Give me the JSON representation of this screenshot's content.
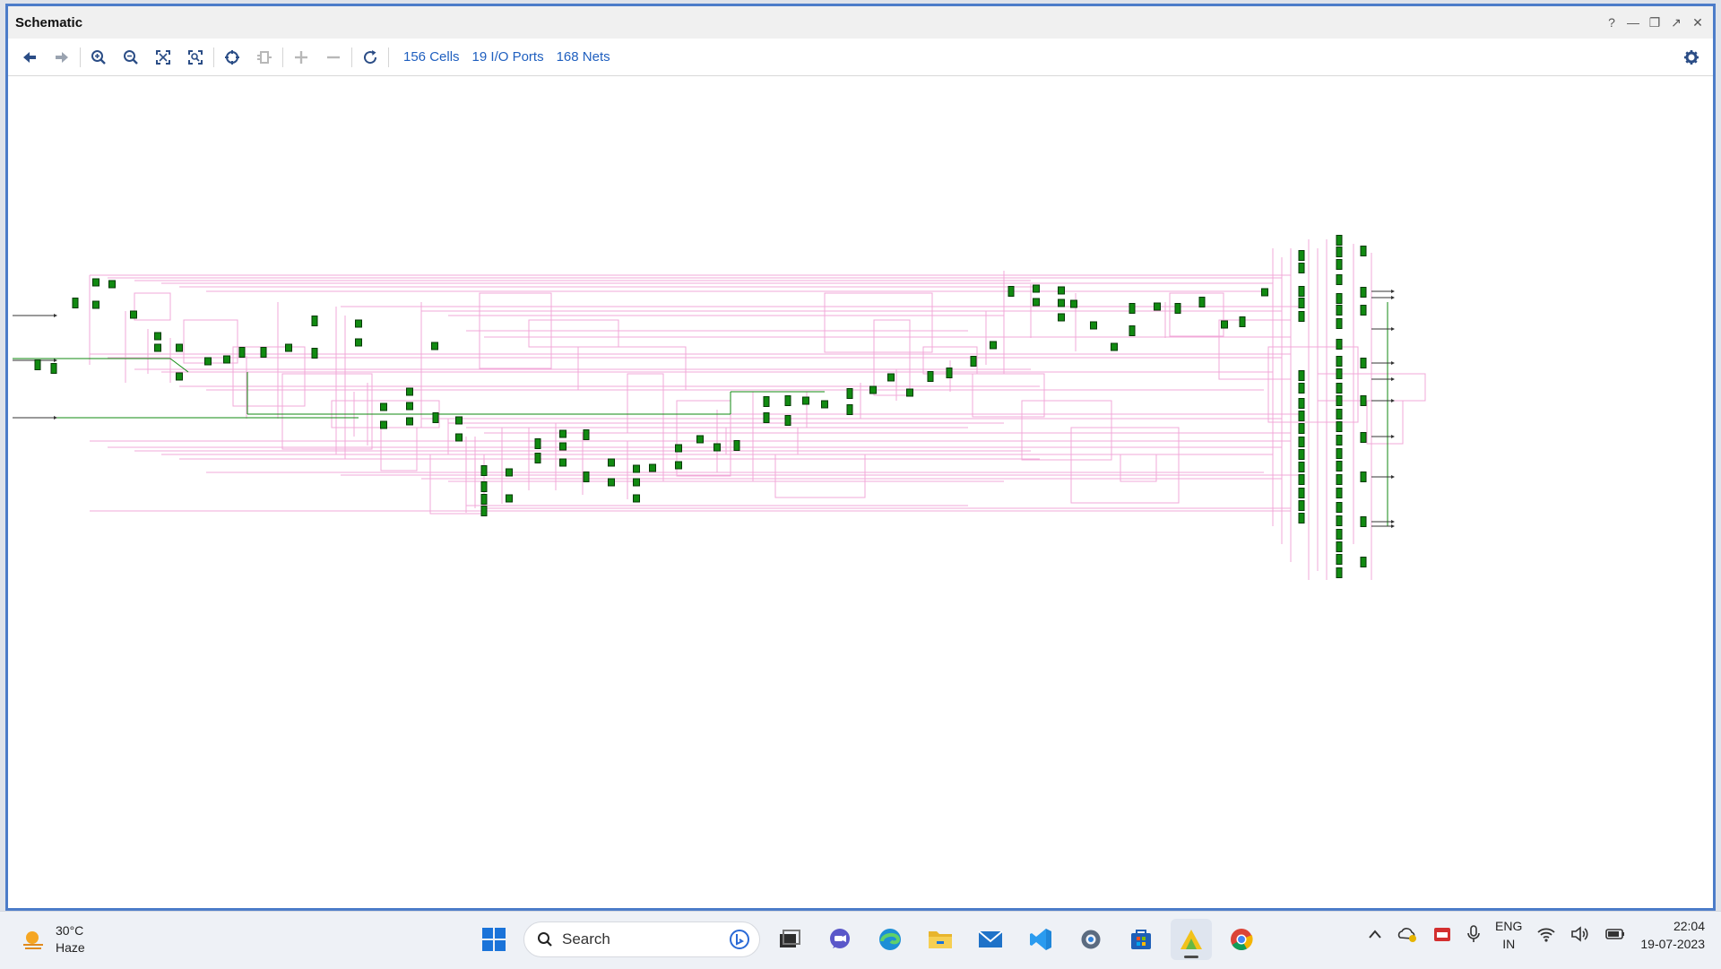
{
  "window": {
    "title": "Schematic",
    "controls": [
      "?",
      "minimize",
      "restore",
      "float",
      "close"
    ]
  },
  "toolbar": {
    "buttons": [
      {
        "name": "back",
        "icon": "arrow-left-icon",
        "enabled": true
      },
      {
        "name": "forward",
        "icon": "arrow-right-icon",
        "enabled": true
      },
      {
        "name": "zoom-in",
        "icon": "zoom-in-icon",
        "enabled": true
      },
      {
        "name": "zoom-out",
        "icon": "zoom-out-icon",
        "enabled": true
      },
      {
        "name": "zoom-fit",
        "icon": "fit-icon",
        "enabled": true
      },
      {
        "name": "zoom-area",
        "icon": "zoom-area-icon",
        "enabled": true
      },
      {
        "name": "select-object",
        "icon": "crosshair-icon",
        "enabled": true
      },
      {
        "name": "expand-cell",
        "icon": "cell-icon",
        "enabled": false
      },
      {
        "name": "add",
        "icon": "plus-icon",
        "enabled": false
      },
      {
        "name": "remove",
        "icon": "minus-icon",
        "enabled": false
      },
      {
        "name": "refresh",
        "icon": "refresh-icon",
        "enabled": true
      }
    ],
    "cells": "156 Cells",
    "ports": "19 I/O Ports",
    "nets": "168 Nets"
  },
  "colors": {
    "net": "#f2a8d8",
    "cell": "#118a11",
    "signal": "#118a11",
    "accent": "#1f5fbf",
    "border": "#4c7cc9"
  },
  "taskbar": {
    "weather_temp": "30°C",
    "weather_desc": "Haze",
    "search_label": "Search",
    "apps": [
      "start",
      "search",
      "task-view",
      "teams-chat",
      "edge",
      "file-explorer",
      "mail",
      "vscode",
      "settings",
      "store",
      "vivado",
      "chrome"
    ],
    "language_line1": "ENG",
    "language_line2": "IN",
    "time": "22:04",
    "date": "19-07-2023"
  }
}
